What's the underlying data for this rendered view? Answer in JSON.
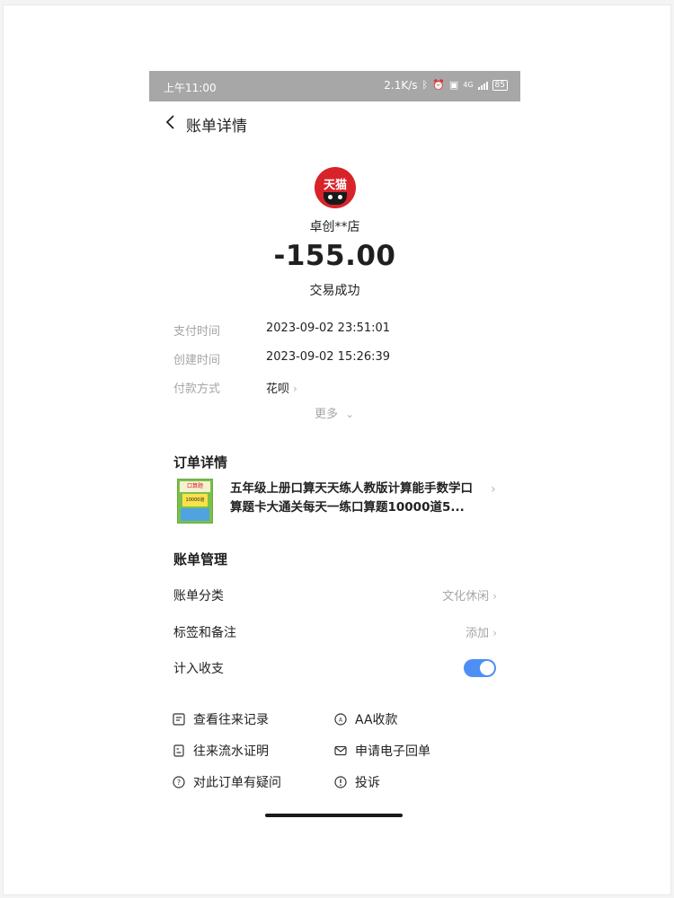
{
  "status_bar": {
    "time": "上午11:00",
    "net_speed": "2.1K/s",
    "network": "4G",
    "battery": "85"
  },
  "nav": {
    "title": "账单详情"
  },
  "merchant": {
    "logo_text": "天猫",
    "name": "卓创**店"
  },
  "transaction": {
    "amount": "-155.00",
    "status": "交易成功"
  },
  "details": [
    {
      "label": "支付时间",
      "value": "2023-09-02 23:51:01"
    },
    {
      "label": "创建时间",
      "value": "2023-09-02 15:26:39"
    },
    {
      "label": "付款方式",
      "value": "花呗"
    }
  ],
  "more_label": "更多",
  "order": {
    "section_title": "订单详情",
    "product_title": "五年级上册口算天天练人教版计算能手数学口算题卡大通关每天一练口算题10000道5...",
    "thumb_top": "口算题",
    "thumb_mid": "10000道"
  },
  "management": {
    "section_title": "账单管理",
    "category_label": "账单分类",
    "category_value": "文化休闲",
    "tags_label": "标签和备注",
    "tags_value": "添加",
    "include_label": "计入收支",
    "include_enabled": true
  },
  "actions": {
    "history": "查看往来记录",
    "aa": "AA收款",
    "statement": "往来流水证明",
    "receipt": "申请电子回单",
    "question": "对此订单有疑问",
    "complaint": "投诉"
  },
  "colors": {
    "accent": "#4e8ff5",
    "tmall_red": "#d8232a",
    "status_bar": "#a7a7a7"
  }
}
